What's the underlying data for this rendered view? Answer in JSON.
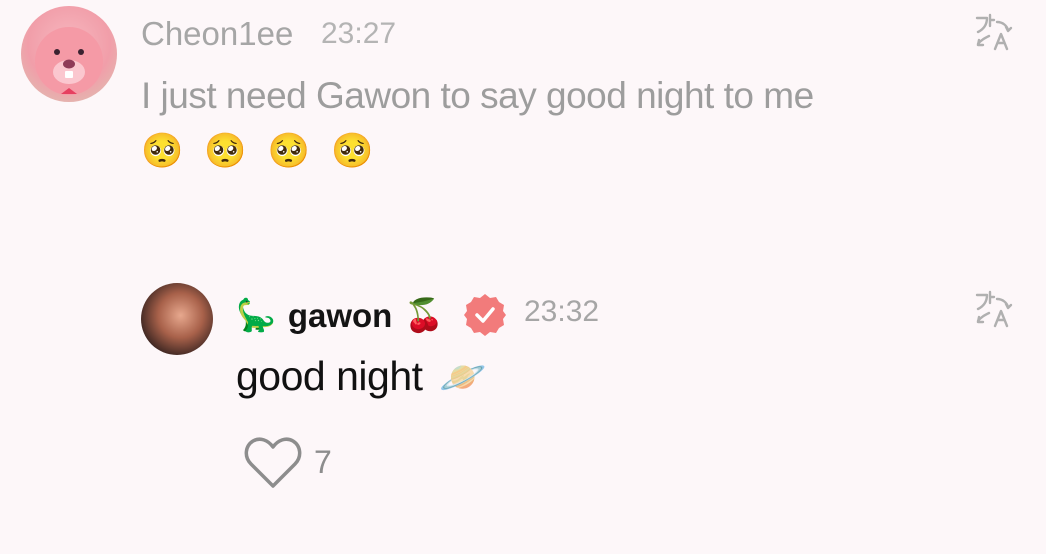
{
  "comment": {
    "author": "Cheon1ee",
    "time": "23:27",
    "text": "I just need Gawon to say good night to me",
    "emojis": [
      "🥺",
      "🥺",
      "🥺",
      "🥺"
    ],
    "translate_icon": "translate-icon"
  },
  "reply": {
    "author_prefix_emoji": "🦕",
    "author": "gawon",
    "author_suffix_emoji": "🍒",
    "verified_icon": "verified-badge-icon",
    "verified_color": "#f27b7b",
    "time": "23:32",
    "text": "good night",
    "text_emoji": "🪐",
    "translate_icon": "translate-icon",
    "like_icon": "heart-icon",
    "like_count": "7"
  }
}
